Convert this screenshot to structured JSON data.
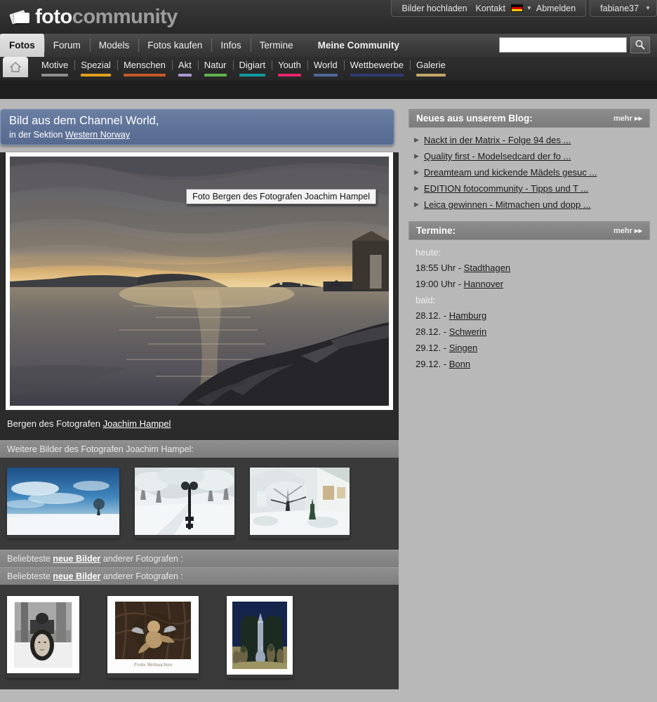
{
  "site": {
    "logo_primary": "foto",
    "logo_secondary": "community"
  },
  "topbar": {
    "links": [
      "Bilder hochladen",
      "Kontakt"
    ],
    "flag_icon": "german-flag-icon",
    "logout_label": "Abmelden",
    "username": "fabiane37"
  },
  "main_tabs": [
    {
      "label": "Fotos",
      "active": true
    },
    {
      "label": "Forum",
      "active": false
    },
    {
      "label": "Models",
      "active": false
    },
    {
      "label": "Fotos kaufen",
      "active": false
    },
    {
      "label": "Infos",
      "active": false
    },
    {
      "label": "Termine",
      "active": false
    },
    {
      "label": "Meine Community",
      "active": false
    }
  ],
  "search": {
    "value": "",
    "placeholder": "",
    "icon": "magnifier-icon"
  },
  "home_icon": "home-icon",
  "categories": [
    {
      "label": "Motive",
      "color": "#8e8e8e"
    },
    {
      "label": "Spezial",
      "color": "#e0a21c"
    },
    {
      "label": "Menschen",
      "color": "#c75a28"
    },
    {
      "label": "Akt",
      "color": "#a99ad0"
    },
    {
      "label": "Natur",
      "color": "#62b14a"
    },
    {
      "label": "Digiart",
      "color": "#0e9aa0"
    },
    {
      "label": "Youth",
      "color": "#e5246e"
    },
    {
      "label": "World",
      "color": "#4f6896"
    },
    {
      "label": "Wettbewerbe",
      "color": "#2e3a72"
    },
    {
      "label": "Galerie",
      "color": "#c4a66a"
    }
  ],
  "banner": {
    "line1": "Bild aus dem Channel World,",
    "line2_prefix": "in der Sektion ",
    "section_link": "Western Norway"
  },
  "photo": {
    "tooltip": "Foto Bergen des Fotografen Joachim Hampel",
    "caption_prefix": "Bergen des Fotografen ",
    "photographer": "Joachim Hampel",
    "alt": "sunset-fjord-photo"
  },
  "more_photos": {
    "header": "Weitere Bilder des Fotografen Joachim Hampel:",
    "thumbs": [
      "winter-field-blue-sky",
      "snowy-avenue-lamppost",
      "snowy-houses-tree"
    ]
  },
  "popular": {
    "header_prefix": "Beliebteste ",
    "header_link": "neue Bilder",
    "header_suffix": " anderer Fotografen :",
    "repeat": 2,
    "thumbs": [
      "bw-portrait-window",
      "angel-statue-christmas",
      "blue-archway-figures"
    ]
  },
  "blog": {
    "title": "Neues aus unserem Blog:",
    "more_label": "mehr",
    "items": [
      "Nackt in der Matrix - Folge 94 des ...",
      "Quality first - Modelsedcard der fo ...",
      "Dreamteam und kickende Mädels gesuc ...",
      "EDITION fotocommunity - Tipps und T ...",
      "Leica gewinnen - Mitmachen und dopp ..."
    ]
  },
  "termine": {
    "title": "Termine:",
    "more_label": "mehr",
    "today_label": "heute:",
    "today": [
      {
        "time": "18:55 Uhr - ",
        "place": "Stadthagen"
      },
      {
        "time": "19:00 Uhr - ",
        "place": "Hannover"
      }
    ],
    "soon_label": "bald:",
    "soon": [
      {
        "date": "28.12. - ",
        "place": "Hamburg"
      },
      {
        "date": "28.12. - ",
        "place": "Schwerin"
      },
      {
        "date": "29.12. - ",
        "place": "Singen"
      },
      {
        "date": "29.12. - ",
        "place": "Bonn"
      }
    ]
  }
}
